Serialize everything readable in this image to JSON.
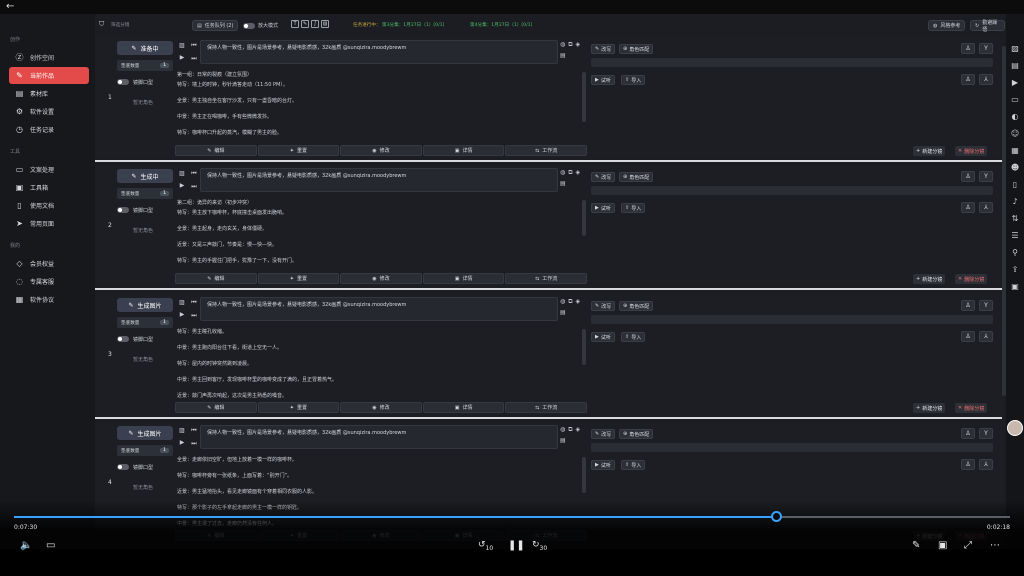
{
  "sidebar": {
    "sections": [
      {
        "title": "创作",
        "items": [
          {
            "label": "创作空间",
            "icon": "z-icon",
            "glyph": "Ⓩ"
          },
          {
            "label": "当前作品",
            "icon": "pencil-icon",
            "glyph": "✎",
            "active": true
          },
          {
            "label": "素材库",
            "icon": "library-icon",
            "glyph": "▤"
          },
          {
            "label": "软件设置",
            "icon": "gear-icon",
            "glyph": "⚙"
          },
          {
            "label": "任务记录",
            "icon": "history-icon",
            "glyph": "◷"
          }
        ]
      },
      {
        "title": "工具",
        "items": [
          {
            "label": "文案处理",
            "icon": "document-icon",
            "glyph": "▭"
          },
          {
            "label": "工具箱",
            "icon": "toolbox-icon",
            "glyph": "▣"
          },
          {
            "label": "使用文档",
            "icon": "book-icon",
            "glyph": "▯"
          },
          {
            "label": "常用页面",
            "icon": "send-icon",
            "glyph": "➤"
          }
        ]
      },
      {
        "title": "我的",
        "items": [
          {
            "label": "会员权益",
            "icon": "diamond-icon",
            "glyph": "◇"
          },
          {
            "label": "专属客服",
            "icon": "chat-icon",
            "glyph": "◌"
          },
          {
            "label": "软件协议",
            "icon": "grid-icon",
            "glyph": "▦"
          }
        ]
      }
    ]
  },
  "filterbar": {
    "filter_placeholder": "筛选分镜",
    "task_button": "任务队列 (2)",
    "zoom_label": "放大模式",
    "progress_label": "任务进行中：",
    "progress_a": "第3分集：1月27日（1）[0/1]",
    "progress_b": "第4分集：1月27日（1）[0/1]",
    "style_button": "风格参考",
    "help_button": "勤避躁悟"
  },
  "prompt_text": "保持人物一致性，图片是场景参考，悬疑电影质感，32k画质 @sunqizira.moodybrewm",
  "common": {
    "sub_label": "垫底数量",
    "sub_count": "1",
    "shot_label": "镜脚口型",
    "no_role": "暂无角色",
    "actions": [
      "编辑",
      "重置",
      "修改",
      "详情",
      "工作流"
    ],
    "action_icons": [
      "edit-icon",
      "sparkle-icon",
      "eye-icon",
      "detail-icon",
      "workflow-icon"
    ],
    "action_glyphs": [
      "✎",
      "✦",
      "◉",
      "▣",
      "⇆"
    ],
    "rewrite": "改写",
    "role_match": "角色匹配",
    "audition": "试听",
    "import": "导入",
    "new_shot": "新建分镜",
    "delete_shot": "删除分镜"
  },
  "rows": [
    {
      "num": "1",
      "status": "准备中",
      "lines": [
        "第一组：日常的裂痕（建立氛围）",
        "特写：墙上的时钟，秒针滴答走动（11:50 PM）。",
        "全景：男主独自坐在客厅沙发，只有一盏昏暗的台灯。",
        "中景：男主正在喝咖啡，手有些微微发抖。",
        "特写：咖啡杯口升起的蒸汽，模糊了男主的脸。"
      ]
    },
    {
      "num": "2",
      "status": "生成中",
      "lines": [
        "第二组：诡异的来访（初步冲突）",
        "特写：男主放下咖啡杯，杯底撞击桌面发出脆响。",
        "全景：男主起身，走向玄关，身体僵硬。",
        "近景：又是三声敲门，节奏是：慢—快—快。",
        "特写：男主的手握住门把手，犹豫了一下，没有开门。"
      ]
    },
    {
      "num": "3",
      "status": "生成图片",
      "lines": [
        "特写：男主瞳孔收缩。",
        "中景：男主跑向阳台往下看，街道上空无一人。",
        "特写：屋内的时钟突然跳到凌晨。",
        "中景：男主回到客厅，发现咖啡杯里的咖啡变成了满的，且正冒着热气。",
        "近景：敲门声再次响起，这次是男主熟悉的嗓音。"
      ]
    },
    {
      "num": "4",
      "status": "生成图片",
      "lines": [
        "全景：走廊依旧空旷，但地上放着一模一样的咖啡杯。",
        "特写：咖啡杯旁有一张纸条，上面写着：“别开门”。",
        "近景：男主猛地抬头，看见走廊镜面有个穿着相同衣服的人影。",
        "特写：那个影子的左手拿起走廊的男主一模一样的钥匙。",
        "中景：男主退了过去，走廊仍然没有任何人。"
      ]
    }
  ],
  "player": {
    "elapsed": "0:07:30",
    "remaining": "0:02:18",
    "progress": 0.765,
    "skip_back": "10",
    "skip_fwd": "30"
  }
}
